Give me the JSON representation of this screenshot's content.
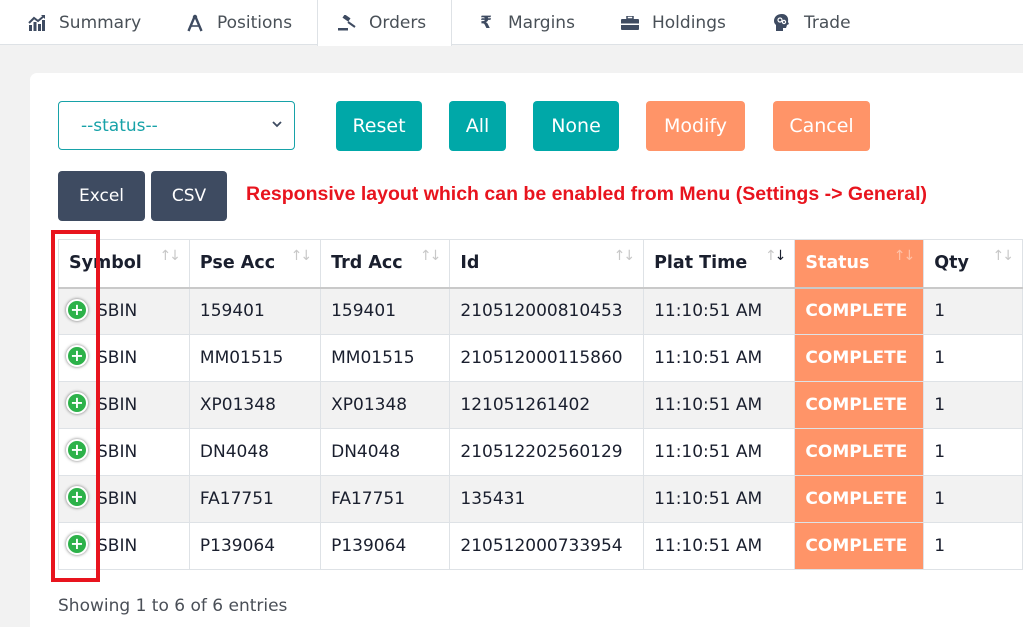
{
  "nav": {
    "tabs": [
      {
        "label": "Summary",
        "icon": "chart-line-icon",
        "active": false
      },
      {
        "label": "Positions",
        "icon": "compass-drafting-icon",
        "active": false
      },
      {
        "label": "Orders",
        "icon": "gavel-icon",
        "active": true
      },
      {
        "label": "Margins",
        "icon": "rupee-icon",
        "active": false
      },
      {
        "label": "Holdings",
        "icon": "briefcase-icon",
        "active": false
      },
      {
        "label": "Trade",
        "icon": "brain-gears-icon",
        "active": false
      }
    ]
  },
  "toolbar": {
    "status_select": {
      "value": "--status--"
    },
    "buttons": {
      "reset": "Reset",
      "all": "All",
      "none": "None",
      "modify": "Modify",
      "cancel": "Cancel",
      "excel": "Excel",
      "csv": "CSV"
    },
    "notice": "Responsive layout which can be enabled from Menu (Settings -> General)"
  },
  "colors": {
    "teal": "#00a8a8",
    "orange": "#ff9468",
    "dark": "#3e4b61",
    "notice_red": "#e8141e",
    "expand_green": "#2db24a"
  },
  "table": {
    "columns": [
      "Symbol",
      "Pse Acc",
      "Trd Acc",
      "Id",
      "Plat Time",
      "Status",
      "Qty"
    ],
    "sorted_column": "Plat Time",
    "highlighted_column": "Status",
    "rows": [
      {
        "symbol": "SBIN",
        "pse_acc": "159401",
        "trd_acc": "159401",
        "id": "210512000810453",
        "plat_time": "11:10:51 AM",
        "status": "COMPLETE",
        "qty": "1"
      },
      {
        "symbol": "SBIN",
        "pse_acc": "MM01515",
        "trd_acc": "MM01515",
        "id": "210512000115860",
        "plat_time": "11:10:51 AM",
        "status": "COMPLETE",
        "qty": "1"
      },
      {
        "symbol": "SBIN",
        "pse_acc": "XP01348",
        "trd_acc": "XP01348",
        "id": "121051261402",
        "plat_time": "11:10:51 AM",
        "status": "COMPLETE",
        "qty": "1"
      },
      {
        "symbol": "SBIN",
        "pse_acc": "DN4048",
        "trd_acc": "DN4048",
        "id": "210512202560129",
        "plat_time": "11:10:51 AM",
        "status": "COMPLETE",
        "qty": "1"
      },
      {
        "symbol": "SBIN",
        "pse_acc": "FA17751",
        "trd_acc": "FA17751",
        "id": "135431",
        "plat_time": "11:10:51 AM",
        "status": "COMPLETE",
        "qty": "1"
      },
      {
        "symbol": "SBIN",
        "pse_acc": "P139064",
        "trd_acc": "P139064",
        "id": "210512000733954",
        "plat_time": "11:10:51 AM",
        "status": "COMPLETE",
        "qty": "1"
      }
    ],
    "info": "Showing 1 to 6 of 6 entries"
  }
}
